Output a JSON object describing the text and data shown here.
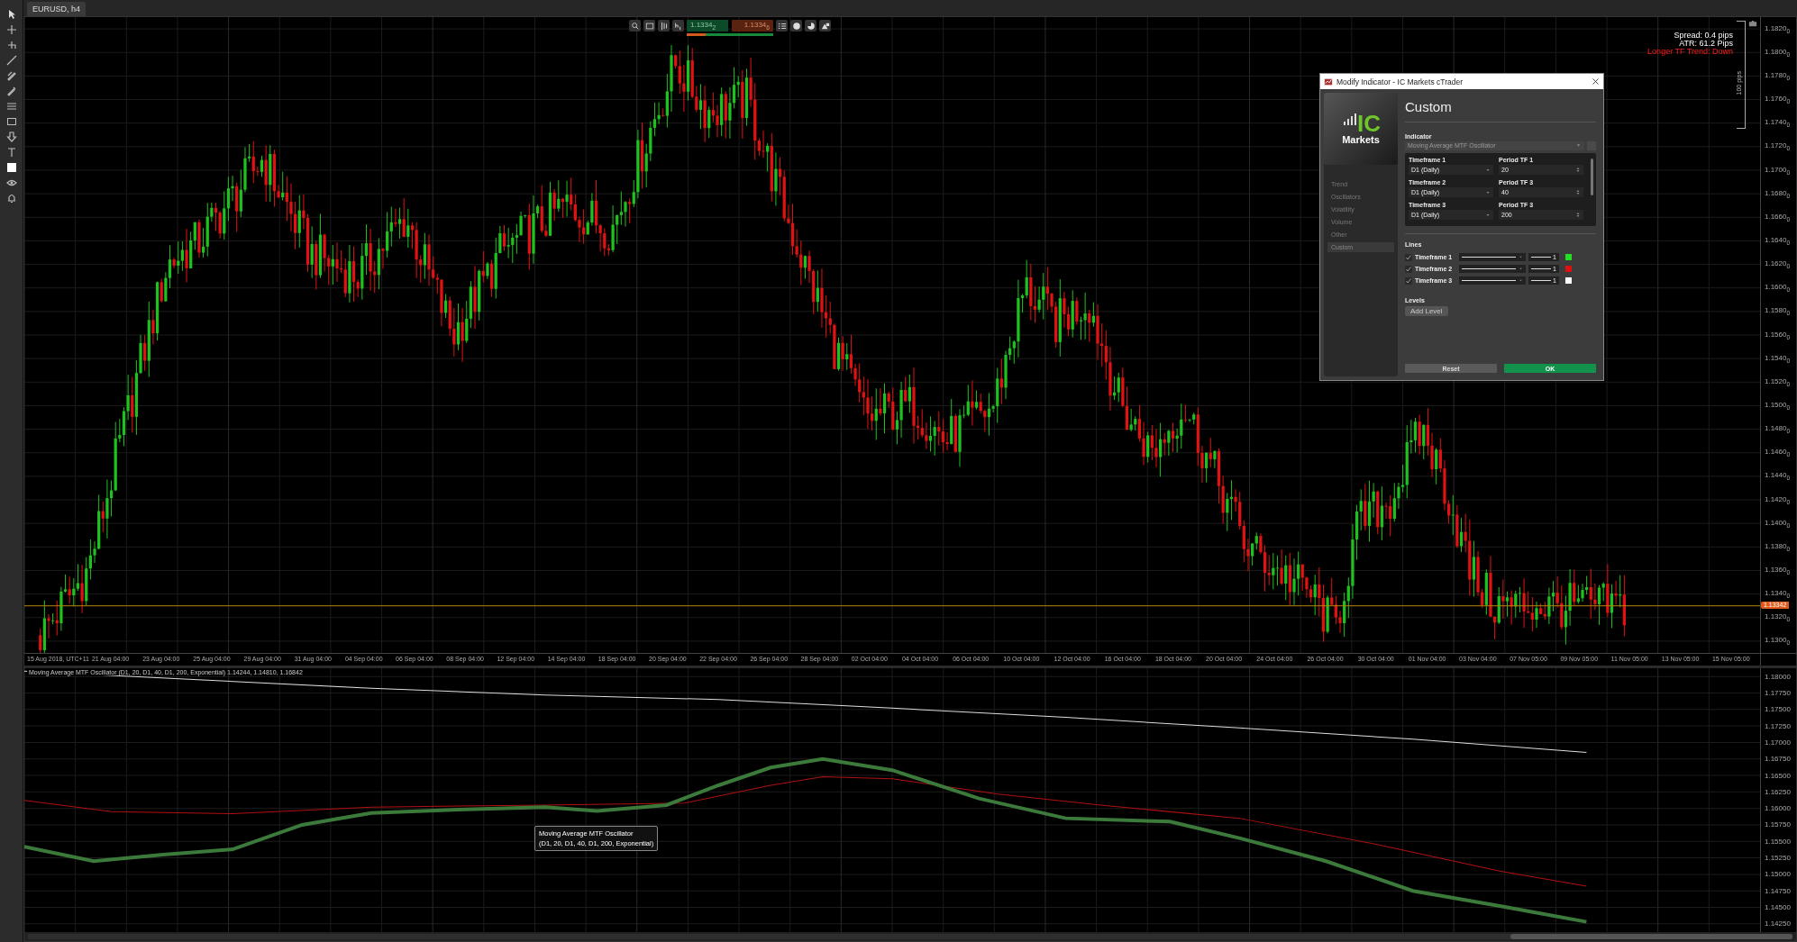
{
  "symbol_tab": {
    "label": "EURUSD, h4",
    "selected": true
  },
  "trade_buttons": [
    {
      "kind": "buy",
      "price": "1.1334$_{2}$"
    },
    {
      "kind": "sell",
      "price": "1.1334$_{6}$"
    }
  ],
  "sentiment": {
    "level": 0.22
  },
  "info": [
    {
      "text": "Spread: 0.4 pips",
      "kind": "stat"
    },
    {
      "text": "ATR: 61.2 Pips",
      "kind": "stat"
    },
    {
      "text": "Longer TF Trend: Down",
      "kind": "alert"
    }
  ],
  "ruler": {
    "label": "100 pips"
  },
  "price_axis": [
    "1.1820$_{0}$",
    "1.1800$_{0}$",
    "1.1780$_{0}$",
    "1.1760$_{0}$",
    "1.1740$_{0}$",
    "1.1720$_{0}$",
    "1.1700$_{0}$",
    "1.1680$_{0}$",
    "1.1660$_{0}$",
    "1.1640$_{0}$",
    "1.1620$_{0}$",
    "1.1600$_{0}$",
    "1.1580$_{0}$",
    "1.1560$_{0}$",
    "1.1540$_{0}$",
    "1.1520$_{0}$",
    "1.1500$_{0}$",
    "1.1480$_{0}$",
    "1.1460$_{0}$",
    "1.1440$_{0}$",
    "1.1420$_{0}$",
    "1.1400$_{0}$",
    "1.1380$_{0}$",
    "1.1360$_{0}$",
    "1.1340$_{0}$",
    "1.1320$_{0}$",
    "1.1300$_{0}$"
  ],
  "current_price": {
    "label": "1.13342"
  },
  "time_axis": [
    "15 Aug 2018, UTC+11",
    "21 Aug 04:00",
    "23 Aug 04:00",
    "25 Aug 04:00",
    "29 Aug 04:00",
    "31 Aug 04:00",
    "04 Sep 04:00",
    "06 Sep 04:00",
    "08 Sep 04:00",
    "12 Sep 04:00",
    "14 Sep 04:00",
    "18 Sep 04:00",
    "20 Sep 04:00",
    "22 Sep 04:00",
    "26 Sep 04:00",
    "28 Sep 04:00",
    "02 Oct 04:00",
    "04 Oct 04:00",
    "06 Oct 04:00",
    "10 Oct 04:00",
    "12 Oct 04:00",
    "16 Oct 04:00",
    "18 Oct 04:00",
    "20 Oct 04:00",
    "24 Oct 04:00",
    "26 Oct 04:00",
    "30 Oct 04:00",
    "01 Nov 04:00",
    "03 Nov 04:00",
    "07 Nov 05:00",
    "09 Nov 05:00",
    "11 Nov 05:00",
    "13 Nov 05:00",
    "15 Nov 05:00"
  ],
  "indicator": {
    "legend": "Moving Average MTF Oscillator (D1, 20, D1, 40, D1, 200, Exponential) 1.14244, 1.14810, 1.16842",
    "axis": [
      "1.18000",
      "1.17750",
      "1.17500",
      "1.17250",
      "1.17000",
      "1.16750",
      "1.16500",
      "1.16250",
      "1.16000",
      "1.15750",
      "1.15500",
      "1.15250",
      "1.15000",
      "1.14750",
      "1.14500",
      "1.14250"
    ],
    "tooltip": {
      "title": "Moving Average MTF Oscillator",
      "detail": "(D1, 20, D1, 40, D1, 200, Exponential)"
    }
  },
  "dialog": {
    "title": "Modify Indicator - IC Markets cTrader",
    "logo": {
      "mark": "IC",
      "word": "Markets"
    },
    "categories": [
      {
        "label": "Trend",
        "selected": false
      },
      {
        "label": "Oscillators",
        "selected": false
      },
      {
        "label": "Volatility",
        "selected": false
      },
      {
        "label": "Volume",
        "selected": false
      },
      {
        "label": "Other",
        "selected": false
      },
      {
        "label": "Custom",
        "selected": true
      }
    ],
    "heading": "Custom",
    "indicator_label": "Indicator",
    "indicator_value": "Moving Average MTF Oscillator",
    "parameters": [
      {
        "label": "Timeframe 1",
        "value": "D1 (Daily)",
        "kind": "dropdown"
      },
      {
        "label": "Period TF 1",
        "value": "20",
        "kind": "spinner"
      },
      {
        "label": "Timeframe 2",
        "value": "D1 (Daily)",
        "kind": "dropdown"
      },
      {
        "label": "Period TF 3",
        "value": "40",
        "kind": "spinner"
      },
      {
        "label": "Timeframe 3",
        "value": "D1 (Daily)",
        "kind": "dropdown"
      },
      {
        "label": "Period TF 3",
        "value": "200",
        "kind": "spinner"
      }
    ],
    "lines_label": "Lines",
    "lines": [
      {
        "label": "Timeframe 1",
        "checked": true,
        "thickness": "1",
        "color": "#22e022"
      },
      {
        "label": "Timeframe 2",
        "checked": true,
        "thickness": "1",
        "color": "#e01010"
      },
      {
        "label": "Timeframe 3",
        "checked": true,
        "thickness": "1",
        "color": "#ffffff"
      }
    ],
    "levels_label": "Levels",
    "add_level": "Add Level",
    "buttons": [
      {
        "label": "Reset",
        "kind": "secondary"
      },
      {
        "label": "OK",
        "kind": "primary"
      }
    ]
  }
}
